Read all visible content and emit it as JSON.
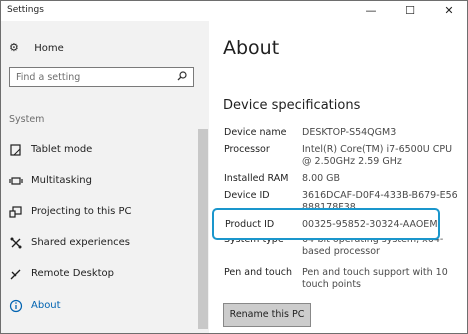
{
  "window": {
    "title": "Settings",
    "minimize": "—",
    "maximize": "☐",
    "close": "✕"
  },
  "sidebar": {
    "home": "Home",
    "search_placeholder": "Find a setting",
    "section": "System",
    "items": [
      {
        "label": "Tablet mode"
      },
      {
        "label": "Multitasking"
      },
      {
        "label": "Projecting to this PC"
      },
      {
        "label": "Shared experiences"
      },
      {
        "label": "Remote Desktop"
      },
      {
        "label": "About"
      }
    ]
  },
  "main": {
    "title": "About",
    "spec_heading": "Device specifications",
    "specs": [
      {
        "label": "Device name",
        "value": "DESKTOP-S54QGM3"
      },
      {
        "label": "Processor",
        "value": "Intel(R) Core(TM) i7-6500U CPU @ 2.50GHz   2.59 GHz"
      },
      {
        "label": "Installed RAM",
        "value": "8.00 GB"
      },
      {
        "label": "Device ID",
        "value": "3616DCAF-D0F4-433B-B679-E56888178F38"
      },
      {
        "label": "Product ID",
        "value": "00325-95852-30324-AAOEM"
      },
      {
        "label": "System type",
        "value": "64-bit operating system, x64-based processor"
      },
      {
        "label": "Pen and touch",
        "value": "Pen and touch support with 10 touch points"
      }
    ],
    "rename_button": "Rename this PC"
  },
  "colors": {
    "accent": "#0063b1",
    "highlight_border": "#1a96cc",
    "sidebar_bg": "#f2f2f2"
  },
  "icons": [
    "settings-gear-icon",
    "search-icon",
    "tablet-mode-icon",
    "multitasking-icon",
    "projecting-icon",
    "shared-experiences-icon",
    "remote-desktop-icon",
    "info-icon"
  ]
}
